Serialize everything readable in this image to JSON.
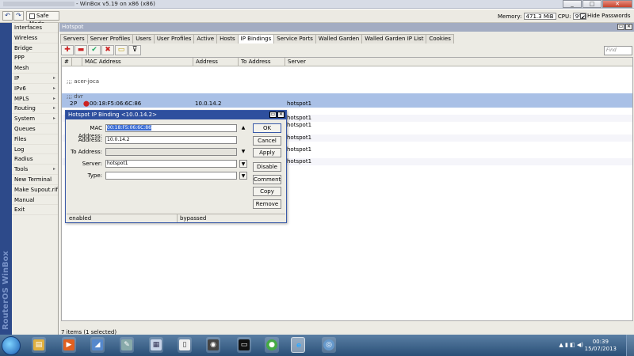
{
  "window": {
    "title": "- WinBox v5.19 on x86 (x86)",
    "minimize": "_",
    "maximize": "□",
    "close": "✕"
  },
  "toolbar": {
    "undo": "↶",
    "redo": "↷",
    "safe_mode": "Safe Mode",
    "memory_label": "Memory:",
    "memory_value": "471.3 MiB",
    "cpu_label": "CPU:",
    "cpu_value": "9%",
    "hide_passwords": "Hide Passwords"
  },
  "brand": "RouterOS WinBox",
  "sidebar": {
    "items": [
      {
        "label": "Interfaces",
        "arrow": ""
      },
      {
        "label": "Wireless",
        "arrow": ""
      },
      {
        "label": "Bridge",
        "arrow": ""
      },
      {
        "label": "PPP",
        "arrow": ""
      },
      {
        "label": "Mesh",
        "arrow": ""
      },
      {
        "label": "IP",
        "arrow": "▸"
      },
      {
        "label": "IPv6",
        "arrow": "▸"
      },
      {
        "label": "MPLS",
        "arrow": "▸"
      },
      {
        "label": "Routing",
        "arrow": "▸"
      },
      {
        "label": "System",
        "arrow": "▸"
      },
      {
        "label": "Queues",
        "arrow": ""
      },
      {
        "label": "Files",
        "arrow": ""
      },
      {
        "label": "Log",
        "arrow": ""
      },
      {
        "label": "Radius",
        "arrow": ""
      },
      {
        "label": "Tools",
        "arrow": "▸"
      },
      {
        "label": "New Terminal",
        "arrow": ""
      },
      {
        "label": "Make Supout.rif",
        "arrow": ""
      },
      {
        "label": "Manual",
        "arrow": ""
      },
      {
        "label": "Exit",
        "arrow": ""
      }
    ]
  },
  "hotspot": {
    "title": "Hotspot",
    "tabs": [
      "Servers",
      "Server Profiles",
      "Users",
      "User Profiles",
      "Active",
      "Hosts",
      "IP Bindings",
      "Service Ports",
      "Walled Garden",
      "Walled Garden IP List",
      "Cookies"
    ],
    "list_tools": [
      "✚",
      "▬",
      "✔",
      "✖",
      "▭",
      "⊽"
    ],
    "find_placeholder": "Find",
    "columns": [
      "#",
      "MAC Address",
      "Address",
      "To Address",
      "Server"
    ],
    "rows": [
      {
        "num": "",
        "flags": "",
        "mac": ";;; acer-joca",
        "address": "",
        "to": "",
        "server": "",
        "comment": true
      },
      {
        "num": "",
        "flags": "",
        "mac": ";;; dvr",
        "address": "",
        "to": "",
        "server": "",
        "comment": true,
        "selected": true
      },
      {
        "num": "2",
        "flags": "P",
        "mac": "00:18:F5:06:6C:86",
        "address": "10.0.14.2",
        "to": "",
        "server": "hotspot1",
        "selected": true
      },
      {
        "num": "",
        "flags": "",
        "mac": "",
        "address": "",
        "to": "",
        "server": "hotspot1"
      },
      {
        "num": "",
        "flags": "",
        "mac": "",
        "address": "",
        "to": "",
        "server": "hotspot1"
      },
      {
        "num": "",
        "flags": "",
        "mac": "",
        "address": "",
        "to": "",
        "server": "hotspot1"
      },
      {
        "num": "",
        "flags": "",
        "mac": "",
        "address": "",
        "to": "",
        "server": "hotspot1"
      },
      {
        "num": "",
        "flags": "",
        "mac": "",
        "address": "",
        "to": "",
        "server": "hotspot1"
      }
    ],
    "status": "7 items (1 selected)"
  },
  "dialog": {
    "title": "Hotspot IP Binding <10.0.14.2>",
    "mac_label": "MAC Address:",
    "mac_value": "00:18:F5:06:6C:86",
    "address_label": "Address:",
    "address_value": "10.0.14.2",
    "to_label": "To Address:",
    "to_value": "",
    "server_label": "Server:",
    "server_value": "hotspot1",
    "type_label": "Type:",
    "type_value": "",
    "buttons": [
      "OK",
      "Cancel",
      "Apply",
      "Disable",
      "Comment",
      "Copy",
      "Remove"
    ],
    "status_left": "enabled",
    "status_right": "bypassed"
  },
  "taskbar": {
    "time": "00:39",
    "date": "15/07/2013"
  }
}
